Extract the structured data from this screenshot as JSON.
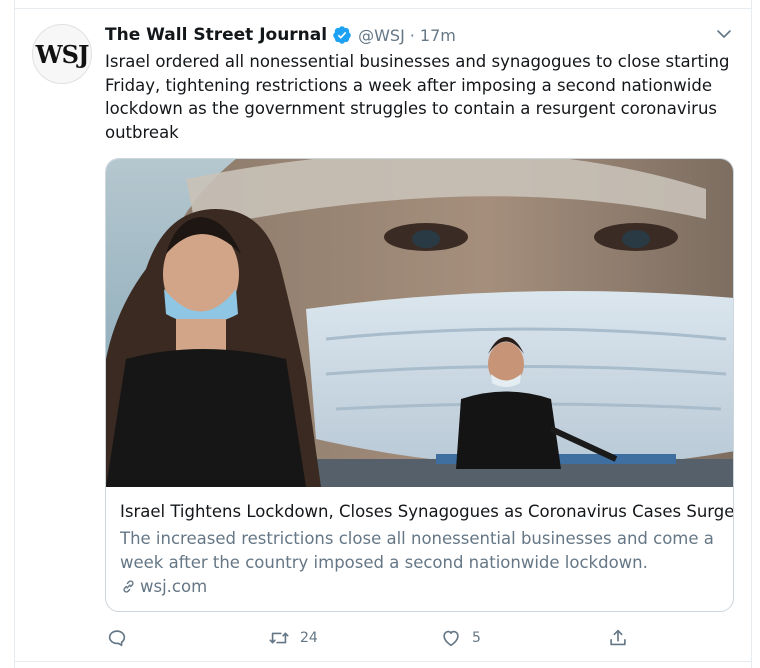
{
  "tweet": {
    "avatar_text": "WSJ",
    "display_name": "The Wall Street Journal",
    "handle": "@WSJ",
    "separator": "·",
    "time": "17m",
    "text": "Israel ordered all nonessential businesses and synagogues to close starting Friday, tightening restrictions a week after imposing a second nationwide lockdown as the government struggles to contain a resurgent coronavirus outbreak"
  },
  "card": {
    "title": "Israel Tightens Lockdown, Closes Synagogues as Coronavirus Cases Surge",
    "description": "The increased restrictions close all nonessential businesses and come a week after the country imposed a second nationwide lockdown.",
    "domain": "wsj.com"
  },
  "actions": {
    "reply_count": "",
    "retweet_count": "24",
    "like_count": "5"
  },
  "colors": {
    "verified": "#1da1f2",
    "secondary_text": "#657786",
    "primary_text": "#14171a"
  },
  "icons": [
    "verified-badge-icon",
    "chevron-down-icon",
    "link-icon",
    "reply-icon",
    "retweet-icon",
    "like-icon",
    "share-icon"
  ]
}
